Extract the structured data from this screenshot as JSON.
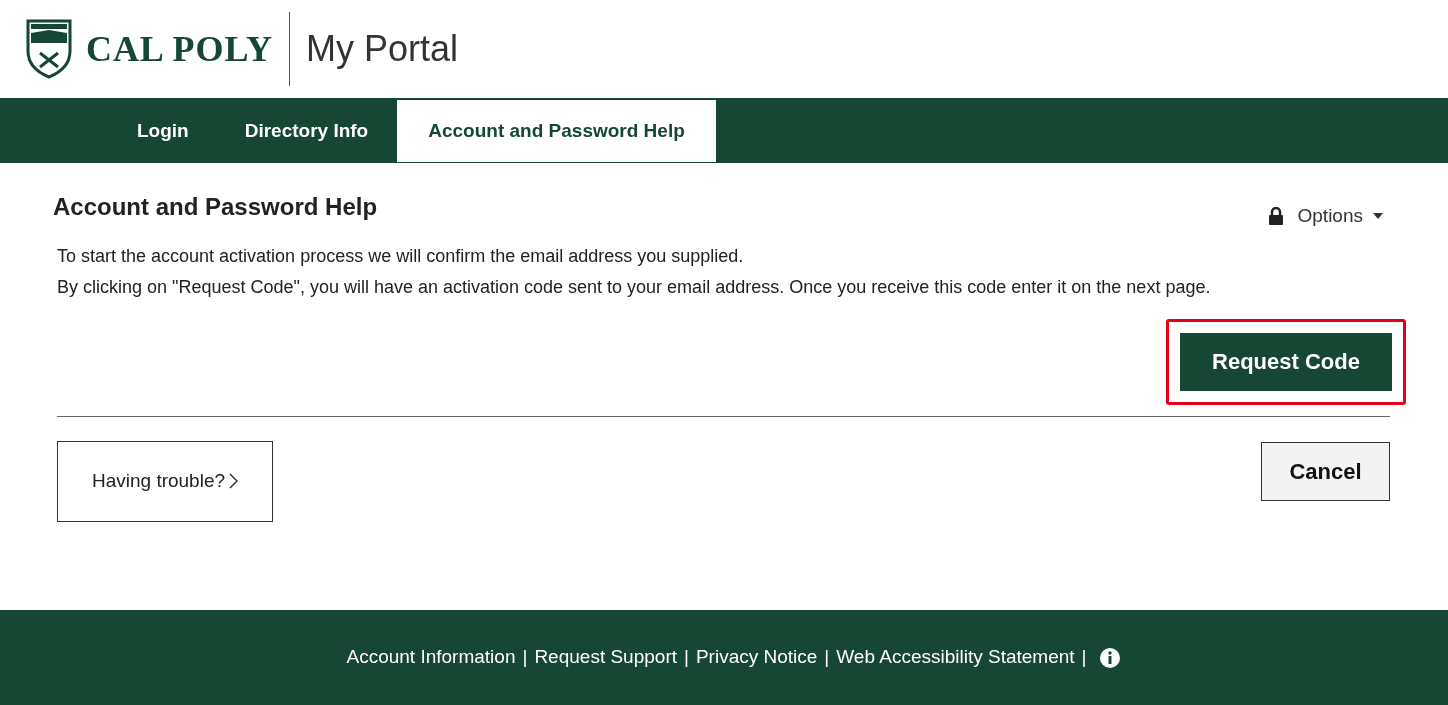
{
  "header": {
    "logo_text": "CAL POLY",
    "title": "My Portal"
  },
  "tabs": [
    {
      "label": "Login",
      "selected": false
    },
    {
      "label": "Directory Info",
      "selected": false
    },
    {
      "label": "Account and Password Help",
      "selected": true
    }
  ],
  "page": {
    "heading": "Account and Password Help",
    "options": "Options",
    "paragraphs": [
      "To start the account activation process we will confirm the email address you supplied.",
      "By clicking on \"Request Code\", you will have an activation code sent to your email address. Once you receive this code enter it on the next page."
    ],
    "primary_button": {
      "label": "Request Code",
      "highlighted": true
    },
    "trouble_link": "Having trouble?",
    "cancel_button": "Cancel"
  },
  "footer": {
    "separator": "|",
    "links": [
      "Account Information",
      "Request Support",
      "Privacy Notice",
      "Web Accessibility Statement"
    ]
  }
}
